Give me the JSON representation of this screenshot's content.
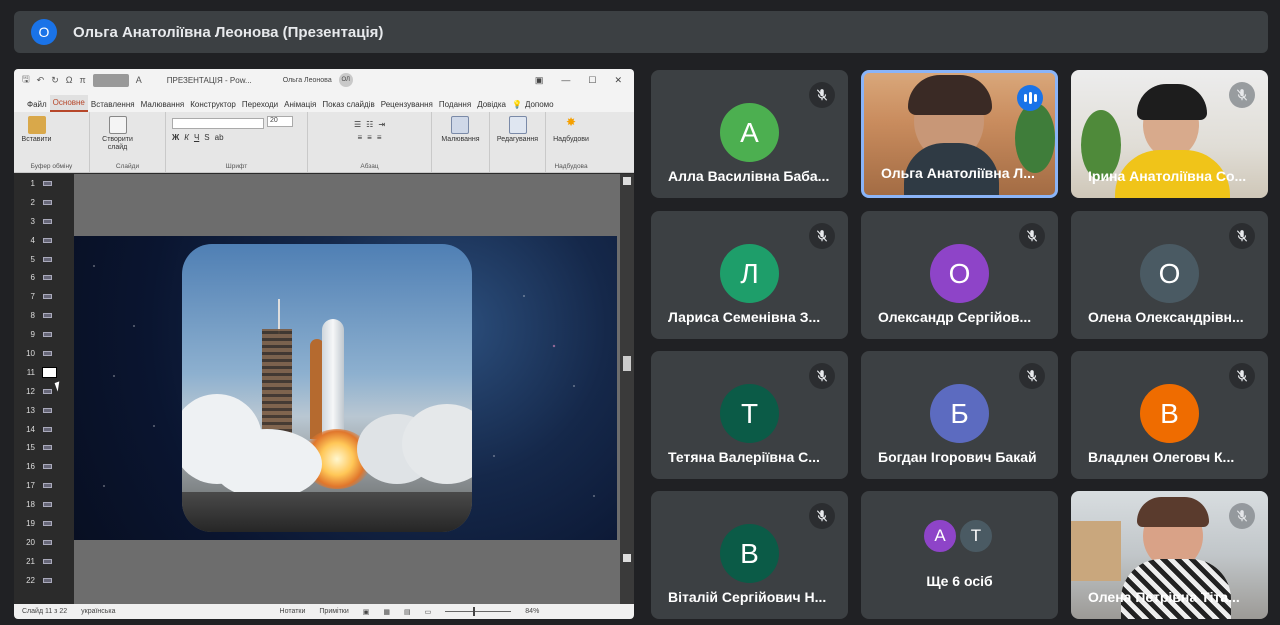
{
  "meeting": {
    "presenter_badge": "O",
    "title": "Ольга Анатоліївна Леонова (Презентація)"
  },
  "ppt": {
    "window_title": "ПРЕЗЕНТАЦІЯ  -  Pow...",
    "user_name": "Ольга Леонова",
    "user_initials": "ОЛ",
    "tabs": [
      "Файл",
      "Основне",
      "Вставлення",
      "Малювання",
      "Конструктор",
      "Переходи",
      "Анімація",
      "Показ слайдів",
      "Рецензування",
      "Подання",
      "Довідка",
      "Допомо"
    ],
    "ribbon": {
      "paste_label": "Вставити",
      "clipboard_group": "Буфер обміну",
      "new_slide_label": "Створити слайд",
      "slides_group": "Слайди",
      "font_size": "20",
      "font_group": "Шрифт",
      "paragraph_group": "Абзац",
      "drawing_label": "Малювання",
      "editing_label": "Редагування",
      "addins_label": "Надбудови",
      "addins_group": "Надбудова"
    },
    "slide_numbers": [
      "1",
      "2",
      "3",
      "4",
      "5",
      "6",
      "7",
      "8",
      "9",
      "10",
      "11",
      "12",
      "13",
      "14",
      "15",
      "16",
      "17",
      "18",
      "19",
      "20",
      "21",
      "22"
    ],
    "selected_slide": "11",
    "status": {
      "slide_info": "Слайд 11 з 22",
      "language": "українська",
      "notes": "Нотатки",
      "comments": "Примітки",
      "zoom": "84%"
    }
  },
  "participants": [
    {
      "name": "Алла Василівна Баба...",
      "initial": "А",
      "color": "#4caf50",
      "video": false
    },
    {
      "name": "Ольга Анатоліївна Л...",
      "initial": "",
      "color": "",
      "video": true,
      "speaking": true
    },
    {
      "name": "Ірина Анатоліївна Со...",
      "initial": "",
      "color": "",
      "video": true
    },
    {
      "name": "Лариса Семенівна З...",
      "initial": "Л",
      "color": "#1e9e6a",
      "video": false
    },
    {
      "name": "Олександр Сергійов...",
      "initial": "О",
      "color": "#8e44c8",
      "video": false
    },
    {
      "name": "Олена Олександрівн...",
      "initial": "О",
      "color": "#4a5a63",
      "video": false
    },
    {
      "name": "Тетяна Валеріївна С...",
      "initial": "Т",
      "color": "#0b5b47",
      "video": false
    },
    {
      "name": "Богдан Ігорович Бакай",
      "initial": "Б",
      "color": "#5c6bc0",
      "video": false
    },
    {
      "name": "Владлен Олеговч К...",
      "initial": "В",
      "color": "#ef6c00",
      "video": false
    },
    {
      "name": "Віталій Сергійович Н...",
      "initial": "В",
      "color": "#0b5b47",
      "video": false
    },
    {
      "name": "Олена Петрівна Тіта...",
      "initial": "",
      "color": "",
      "video": true
    }
  ],
  "others": {
    "label": "Ще 6 осіб",
    "avatars": [
      {
        "initial": "А",
        "color": "#8e44c8"
      },
      {
        "initial": "Т",
        "color": "#4a5a63"
      }
    ]
  }
}
